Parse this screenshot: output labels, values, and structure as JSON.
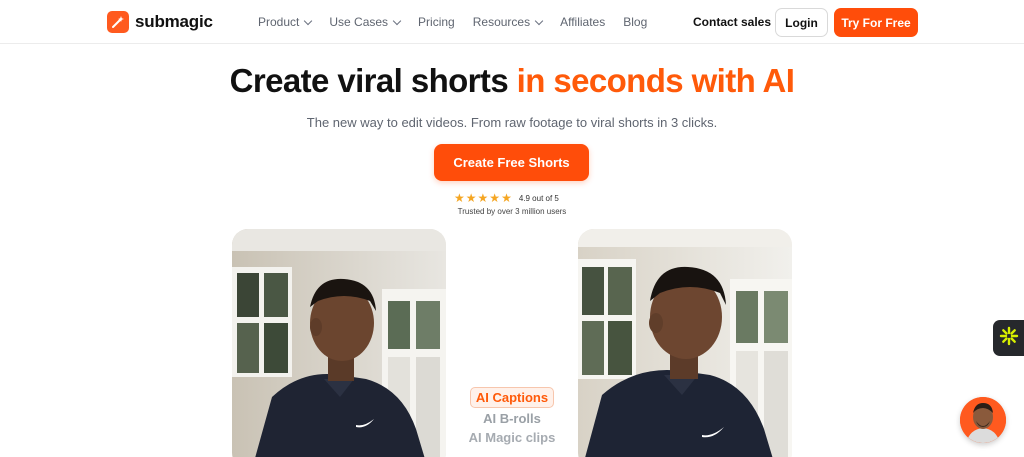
{
  "brand": {
    "name": "submagic",
    "accent": "#ff4d0a"
  },
  "nav": {
    "items": [
      {
        "label": "Product",
        "dropdown": true
      },
      {
        "label": "Use Cases",
        "dropdown": true
      },
      {
        "label": "Pricing",
        "dropdown": false
      },
      {
        "label": "Resources",
        "dropdown": true
      },
      {
        "label": "Affiliates",
        "dropdown": false
      },
      {
        "label": "Blog",
        "dropdown": false
      }
    ],
    "contact_label": "Contact sales",
    "login_label": "Login",
    "try_label": "Try For Free"
  },
  "hero": {
    "headline_main": "Create viral shorts ",
    "headline_accent": "in seconds with AI",
    "subtitle": "The new way to edit videos. From raw footage to viral shorts in 3 clicks.",
    "cta_label": "Create Free Shorts",
    "rating_stars": 5,
    "rating_text": "4.9 out of 5",
    "trusted_text": "Trusted by over 3 million users"
  },
  "features": {
    "active": "AI Captions",
    "items": [
      "AI B-rolls",
      "AI Magic clips"
    ]
  },
  "icons": {
    "logo": "submagic-logo-icon",
    "side_widget": "asterisk-icon",
    "chat": "avatar-chat-icon"
  }
}
